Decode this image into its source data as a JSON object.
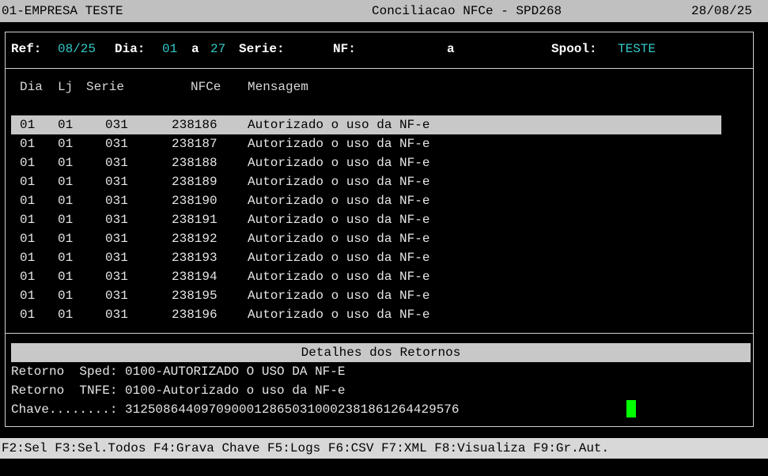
{
  "title_bar": {
    "company": "01-EMPRESA TESTE",
    "screen": "Conciliacao NFCe - SPD268",
    "date": "28/08/25"
  },
  "filters": {
    "ref_label": "Ref:",
    "ref_value": "08/25",
    "dia_label": "Dia:",
    "dia_from": "01",
    "dia_to_label": "a",
    "dia_to": "27",
    "serie_label": "Serie:",
    "nf_label": "NF:",
    "nf_to_label": "a",
    "spool_label": "Spool:",
    "spool_value": "TESTE"
  },
  "columns": {
    "dia": "Dia",
    "lj": "Lj",
    "serie": "Serie",
    "nfce": "NFCe",
    "mensagem": "Mensagem"
  },
  "rows": [
    {
      "dia": "01",
      "lj": "01",
      "serie": "031",
      "nfce": "238186",
      "mensagem": "Autorizado o uso da NF-e"
    },
    {
      "dia": "01",
      "lj": "01",
      "serie": "031",
      "nfce": "238187",
      "mensagem": "Autorizado o uso da NF-e"
    },
    {
      "dia": "01",
      "lj": "01",
      "serie": "031",
      "nfce": "238188",
      "mensagem": "Autorizado o uso da NF-e"
    },
    {
      "dia": "01",
      "lj": "01",
      "serie": "031",
      "nfce": "238189",
      "mensagem": "Autorizado o uso da NF-e"
    },
    {
      "dia": "01",
      "lj": "01",
      "serie": "031",
      "nfce": "238190",
      "mensagem": "Autorizado o uso da NF-e"
    },
    {
      "dia": "01",
      "lj": "01",
      "serie": "031",
      "nfce": "238191",
      "mensagem": "Autorizado o uso da NF-e"
    },
    {
      "dia": "01",
      "lj": "01",
      "serie": "031",
      "nfce": "238192",
      "mensagem": "Autorizado o uso da NF-e"
    },
    {
      "dia": "01",
      "lj": "01",
      "serie": "031",
      "nfce": "238193",
      "mensagem": "Autorizado o uso da NF-e"
    },
    {
      "dia": "01",
      "lj": "01",
      "serie": "031",
      "nfce": "238194",
      "mensagem": "Autorizado o uso da NF-e"
    },
    {
      "dia": "01",
      "lj": "01",
      "serie": "031",
      "nfce": "238195",
      "mensagem": "Autorizado o uso da NF-e"
    },
    {
      "dia": "01",
      "lj": "01",
      "serie": "031",
      "nfce": "238196",
      "mensagem": "Autorizado o uso da NF-e"
    }
  ],
  "details": {
    "header": "Detalhes dos Retornos",
    "sped_line": "Retorno  Sped: 0100-AUTORIZADO O USO DA NF-E",
    "tnfe_line": "Retorno  TNFE: 0100-Autorizado o uso da NF-e",
    "chave_line": "Chave........: 31250864409709000128650310002381861264429576"
  },
  "function_keys": "F2:Sel F3:Sel.Todos F4:Grava Chave F5:Logs F6:CSV F7:XML F8:Visualiza F9:Gr.Aut."
}
